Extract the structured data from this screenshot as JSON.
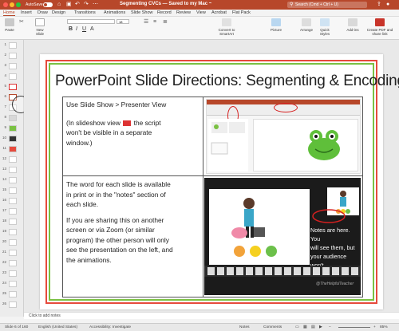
{
  "titlebar": {
    "autosave_label": "AutoSave",
    "autosave_state": "OFF",
    "doc_title": "Segmenting CVCs — Saved to my Mac ~",
    "search_placeholder": "Search (Cmd + Ctrl + U)",
    "accent": "#b7472a"
  },
  "tabs": [
    "Home",
    "Insert",
    "Draw",
    "Design",
    "Transitions",
    "Animations",
    "Slide Show",
    "Record",
    "Review",
    "View",
    "Acrobat",
    "Flat Pack"
  ],
  "tabs_active": "Home",
  "ribbon": {
    "paste": "Paste",
    "new_slide": "New Slide",
    "convert_smartart": "Convert to SmartArt",
    "picture": "Picture",
    "arrange": "Arrange",
    "quick_styles": "Quick Styles",
    "addins": "Add-ins",
    "create_pdf": "Create PDF and share link",
    "font_size": "18"
  },
  "thumbnails": [
    "1",
    "2",
    "3",
    "4",
    "5",
    "6",
    "7",
    "8",
    "9",
    "10",
    "11",
    "12",
    "13",
    "14",
    "15",
    "16",
    "17",
    "18",
    "19",
    "20",
    "21",
    "22",
    "23",
    "24",
    "25",
    "26"
  ],
  "slide": {
    "title": "PowerPoint Slide Directions: Segmenting & Encoding",
    "cell1_line1": "Use Slide Show > Presenter View",
    "cell1_line2a": "(In slideshow view",
    "cell1_line2b": "the script",
    "cell1_line3": "won't be visible in a separate",
    "cell1_line4": "window.)",
    "cell2_p1_l1": "The word for each slide is available",
    "cell2_p1_l2": "in print or in the \"notes\" section of",
    "cell2_p1_l3": "each slide.",
    "cell2_p2_l1": "If you are sharing this on another",
    "cell2_p2_l2": "screen or via Zoom (or similar",
    "cell2_p2_l3": "program) the other person will only",
    "cell2_p2_l4": "see the presentation on the left, and",
    "cell2_p2_l5": "the animations.",
    "notes_l1": "Notes are here.  You",
    "notes_l2": "will see them, but",
    "notes_l3": "your audience won't.",
    "credit": "@TheHelpfulTeacher"
  },
  "notes_placeholder": "Click to add notes",
  "status": {
    "slide_count": "Slide 6 of 160",
    "language": "English (United States)",
    "accessibility": "Accessibility: Investigate",
    "notes": "Notes",
    "comments": "Comments",
    "zoom": "85%"
  }
}
